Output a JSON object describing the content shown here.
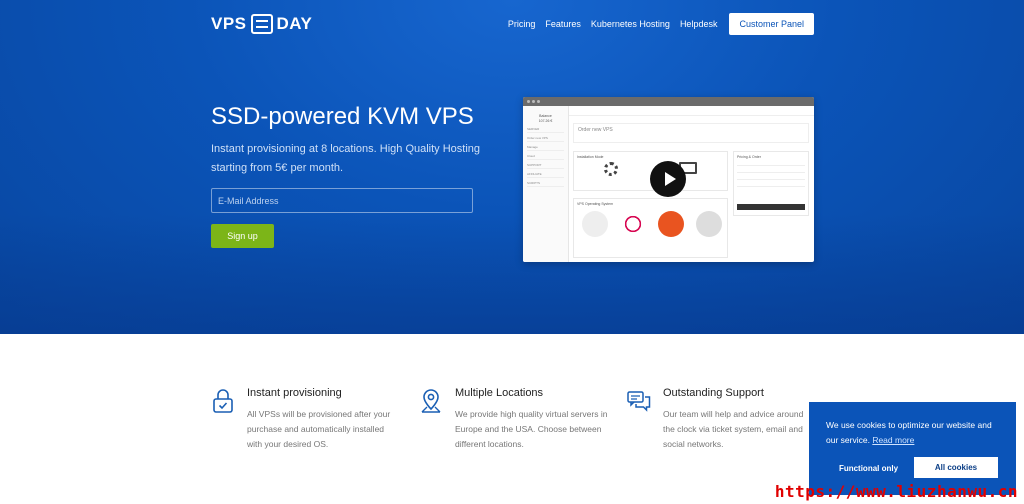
{
  "brand": {
    "logo_left": "VPS",
    "logo_right": "DAY"
  },
  "nav": {
    "items": [
      {
        "label": "Pricing"
      },
      {
        "label": "Features"
      },
      {
        "label": "Kubernetes Hosting"
      },
      {
        "label": "Helpdesk"
      }
    ],
    "panel_button": "Customer Panel"
  },
  "hero": {
    "title": "SSD-powered KVM VPS",
    "subtitle": "Instant provisioning at 8 locations. High Quality Hosting starting from 5€ per month.",
    "email_placeholder": "E-Mail Address",
    "signup_label": "Sign up"
  },
  "preview": {
    "balance_label": "Balance",
    "balance_value": "107.26 €",
    "sidebar_rows": [
      "SERVER",
      "Order new VPS",
      "Manage",
      "Cloud",
      "SUPPORT",
      "AFFILIATE",
      "SCRIPTS"
    ],
    "page_title": "Order new VPS",
    "installation_title": "Installation Mode",
    "pricing_title": "Pricing & Order",
    "os_title": "VPS Operating System",
    "order_label": "Order server"
  },
  "features": [
    {
      "icon": "lock-icon",
      "title": "Instant provisioning",
      "text": "All VPSs will be provisioned after your purchase and automatically installed with your desired OS."
    },
    {
      "icon": "map-pin-icon",
      "title": "Multiple Locations",
      "text": "We provide high quality virtual servers in Europe and the USA. Choose between different locations."
    },
    {
      "icon": "chat-bubbles-icon",
      "title": "Outstanding Support",
      "text": "Our team will help and advice around the clock via ticket system, email and social networks."
    }
  ],
  "cookie": {
    "message": "We use cookies to optimize our website and our service.",
    "read_more": "Read more",
    "functional_label": "Functional only",
    "all_label": "All cookies"
  },
  "watermark": "https://www.liuzhanwu.cn",
  "colors": {
    "brand_blue": "#0b54b8",
    "signup_green": "#7cb518",
    "icon_blue": "#1a5fb4",
    "watermark_red": "#e00000"
  }
}
